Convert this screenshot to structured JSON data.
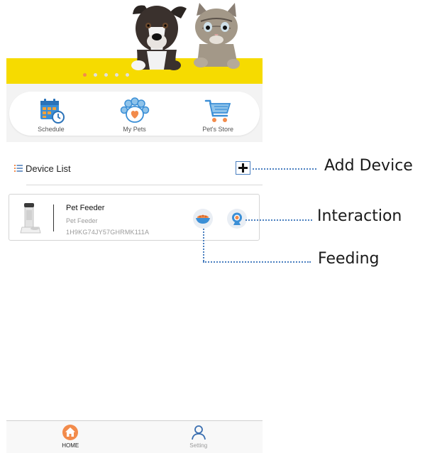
{
  "banner": {
    "carousel_count": 5,
    "active_index": 0
  },
  "menu": {
    "items": [
      {
        "label": "Schedule",
        "icon": "calendar-clock-icon"
      },
      {
        "label": "My Pets",
        "icon": "paw-heart-icon"
      },
      {
        "label": "Pet's Store",
        "icon": "shopping-cart-icon"
      }
    ]
  },
  "device_list": {
    "title": "Device List",
    "devices": [
      {
        "name": "Pet Feeder",
        "type": "Pet Feeder",
        "id": "1H9KG74JY57GHRMK111A"
      }
    ]
  },
  "tabbar": {
    "tabs": [
      {
        "label": "HOME",
        "active": true
      },
      {
        "label": "Setting",
        "active": false
      }
    ]
  },
  "callouts": {
    "add_device": "Add Device",
    "interaction": "Interaction",
    "feeding": "Feeding"
  },
  "colors": {
    "banner_yellow": "#f6db00",
    "accent_orange": "#f28b4b",
    "icon_blue": "#3b8fd6",
    "callout_blue": "#4a7fc0"
  }
}
